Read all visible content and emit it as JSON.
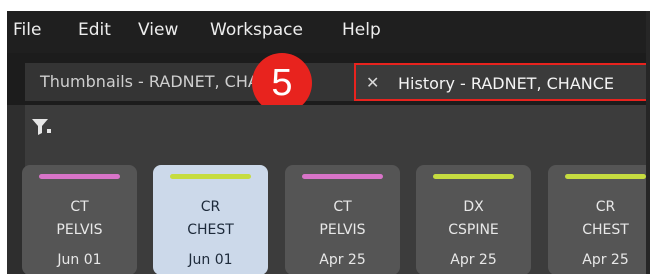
{
  "menu": [
    "File",
    "Edit",
    "View",
    "Workspace",
    "Help"
  ],
  "tabs": {
    "thumbnails_label": "Thumbnails - RADNET, CHANCE",
    "history_label": "History - RADNET, CHANCE",
    "close_glyph": "✕"
  },
  "callout": {
    "number": "5",
    "color": "#e8231e"
  },
  "studies": [
    {
      "modality": "CT",
      "body_part": "PELVIS",
      "date": "Jun 01",
      "bar_color": "#d874c8",
      "selected": false
    },
    {
      "modality": "CR",
      "body_part": "CHEST",
      "date": "Jun 01",
      "bar_color": "#c6dc40",
      "selected": true
    },
    {
      "modality": "CT",
      "body_part": "PELVIS",
      "date": "Apr 25",
      "bar_color": "#d874c8",
      "selected": false
    },
    {
      "modality": "DX",
      "body_part": "CSPINE",
      "date": "Apr 25",
      "bar_color": "#c6dc40",
      "selected": false
    },
    {
      "modality": "CR",
      "body_part": "CHEST",
      "date": "Apr 25",
      "bar_color": "#c6dc40",
      "selected": false
    }
  ]
}
